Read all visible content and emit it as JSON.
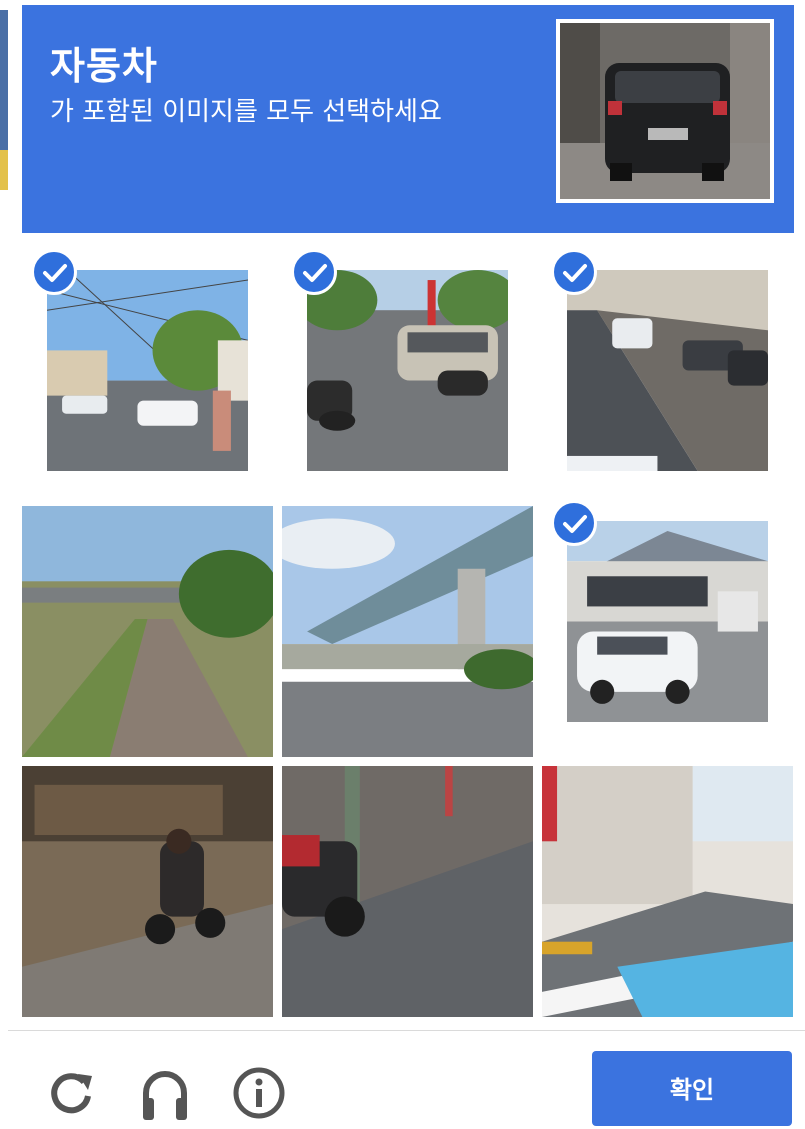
{
  "challenge": {
    "title": "자동차",
    "instruction": "가 포함된 이미지를 모두 선택하세요"
  },
  "sample_image": {
    "name": "car-rear-view"
  },
  "tiles": [
    {
      "name": "street-cars-tram-wires",
      "selected": true
    },
    {
      "name": "intersection-minivan-motorbikes",
      "selected": true
    },
    {
      "name": "parked-cars-street",
      "selected": true
    },
    {
      "name": "road-under-overpass",
      "selected": false
    },
    {
      "name": "highway-overpass-road",
      "selected": false
    },
    {
      "name": "white-car-gas-station",
      "selected": true
    },
    {
      "name": "motorcyclist-dirt-road",
      "selected": false
    },
    {
      "name": "motorcycle-sidewalk",
      "selected": false
    },
    {
      "name": "crosswalk-street",
      "selected": false
    }
  ],
  "footer": {
    "verify_label": "확인",
    "icons": [
      "reload-icon",
      "audio-headphones-icon",
      "info-icon"
    ]
  },
  "colors": {
    "accent": "#3b73df",
    "check": "#2f6fdc"
  }
}
